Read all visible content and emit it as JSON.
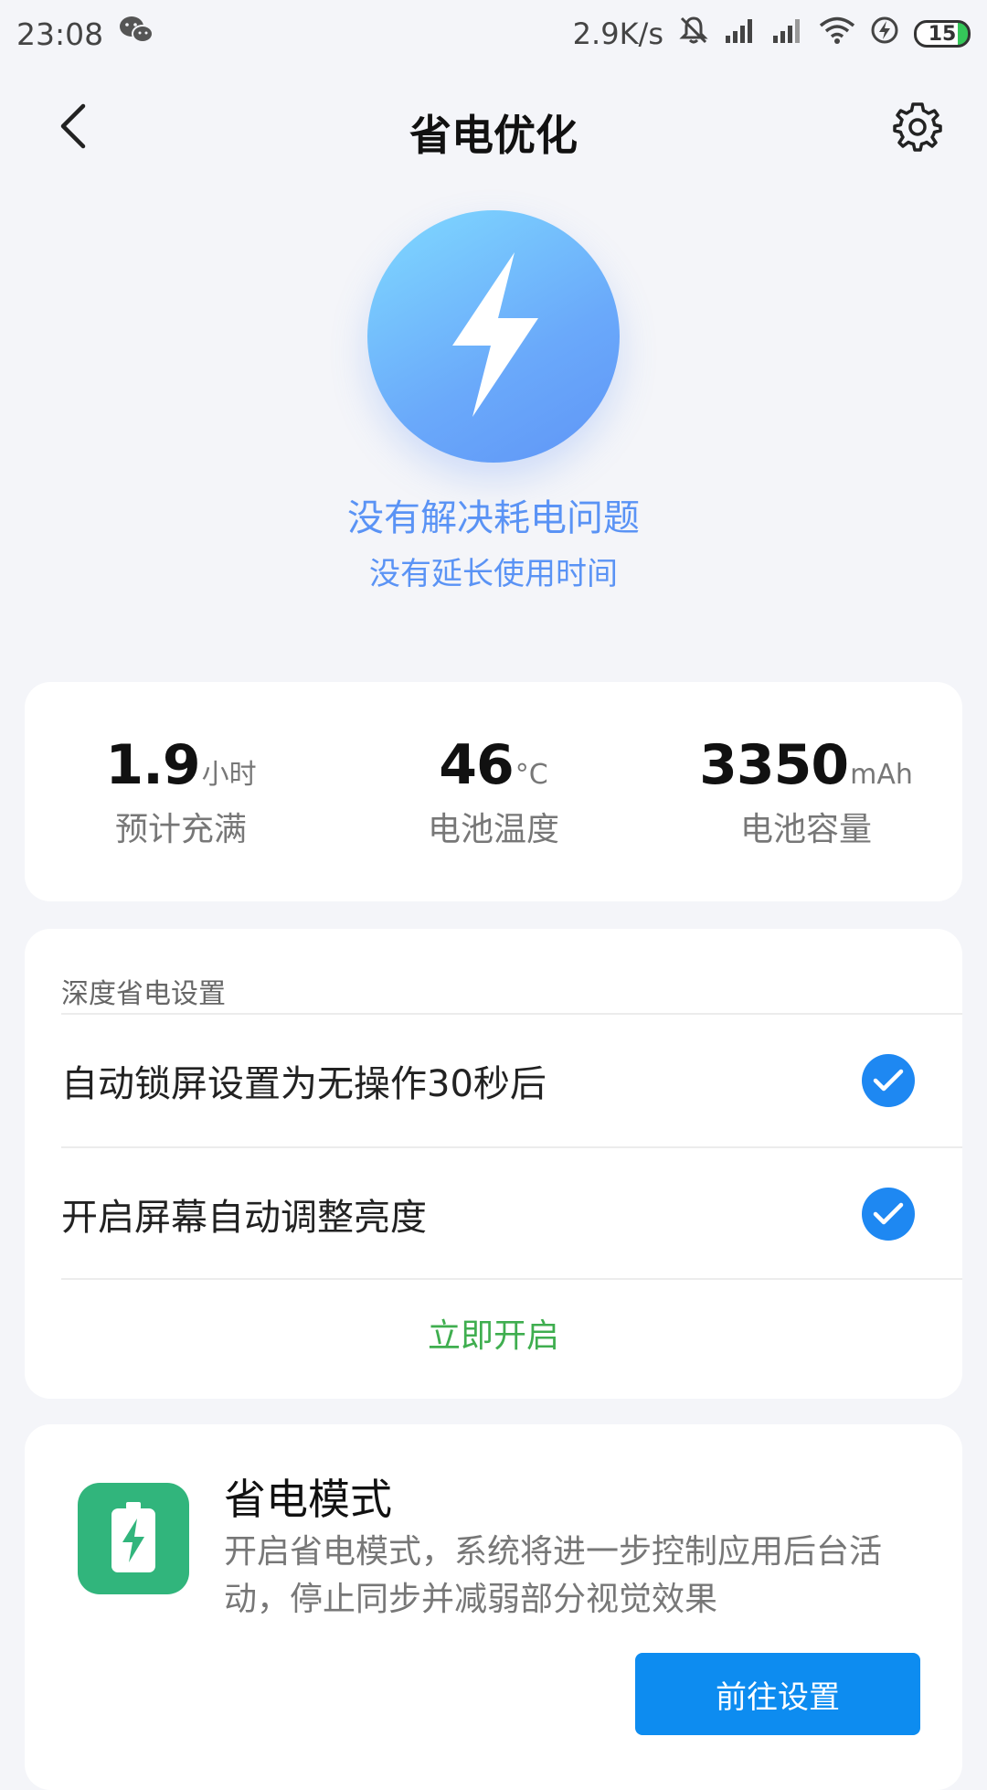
{
  "status_bar": {
    "time": "23:08",
    "net_speed": "2.9K/s",
    "battery_level": "15"
  },
  "header": {
    "title": "省电优化"
  },
  "hero": {
    "title": "没有解决耗电问题",
    "subtitle": "没有延长使用时间"
  },
  "stats": [
    {
      "value": "1.9",
      "unit": "小时",
      "label": "预计充满"
    },
    {
      "value": "46",
      "unit": "°C",
      "label": "电池温度"
    },
    {
      "value": "3350",
      "unit": "mAh",
      "label": "电池容量"
    }
  ],
  "deep_saving": {
    "section_title": "深度省电设置",
    "options": [
      {
        "label": "自动锁屏设置为无操作30秒后",
        "checked": true
      },
      {
        "label": "开启屏幕自动调整亮度",
        "checked": true
      }
    ],
    "action_label": "立即开启"
  },
  "power_mode": {
    "title": "省电模式",
    "description": "开启省电模式，系统将进一步控制应用后台活动，停止同步并减弱部分视觉效果",
    "button_label": "前往设置"
  },
  "colors": {
    "accent_blue": "#1e88f2",
    "action_green": "#3fae4f",
    "mode_icon_green": "#31b57c",
    "hero_text_blue": "#5a93f5"
  }
}
